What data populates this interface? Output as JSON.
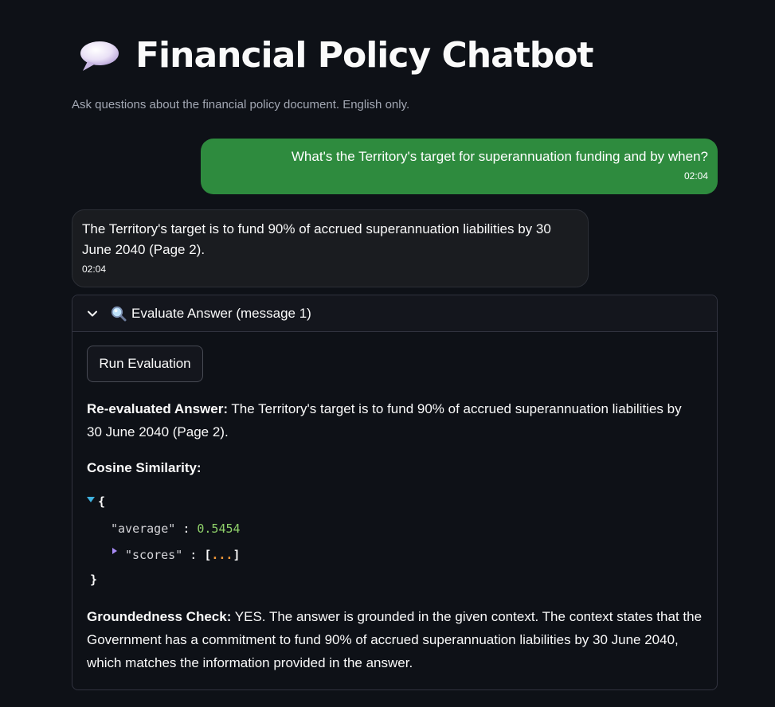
{
  "app": {
    "title": "Financial Policy Chatbot",
    "subtitle": "Ask questions about the financial policy document. English only.",
    "title_icon": "speech-bubble-icon"
  },
  "chat": {
    "user_message": {
      "text": "What's the Territory's target for superannuation funding and by when?",
      "time": "02:04"
    },
    "bot_message": {
      "text": "The Territory's target is to fund 90% of accrued superannuation liabilities by 30 June 2040 (Page 2).",
      "time": "02:04"
    }
  },
  "evaluation": {
    "expander_label": "Evaluate Answer (message 1)",
    "expander_icon": "magnifier-icon",
    "run_button_label": "Run Evaluation",
    "reevaluated_label": "Re-evaluated Answer:",
    "reevaluated_text": " The Territory's target is to fund 90% of accrued superannuation liabilities by 30 June 2040 (Page 2).",
    "cosine_label": "Cosine Similarity:",
    "json": {
      "open_brace": "{",
      "close_brace": "}",
      "average_key": "\"average\"",
      "average_value": "0.5454",
      "scores_key": "\"scores\"",
      "scores_collapsed": "[...]",
      "colon": ":"
    },
    "groundedness_label": "Groundedness Check:",
    "groundedness_text": " YES. The answer is grounded in the given context. The context states that the Government has a commitment to fund 90% of accrued superannuation liabilities by 30 June 2040, which matches the information provided in the answer."
  },
  "colors": {
    "background": "#0e1117",
    "user_bubble": "#2e8b3e",
    "bot_bubble": "#1a1c20",
    "json_number": "#8fd16a",
    "json_ellipsis": "#f59b3a",
    "json_expand_arrow": "#3fb2e0",
    "json_collapse_arrow": "#a98cf6"
  }
}
